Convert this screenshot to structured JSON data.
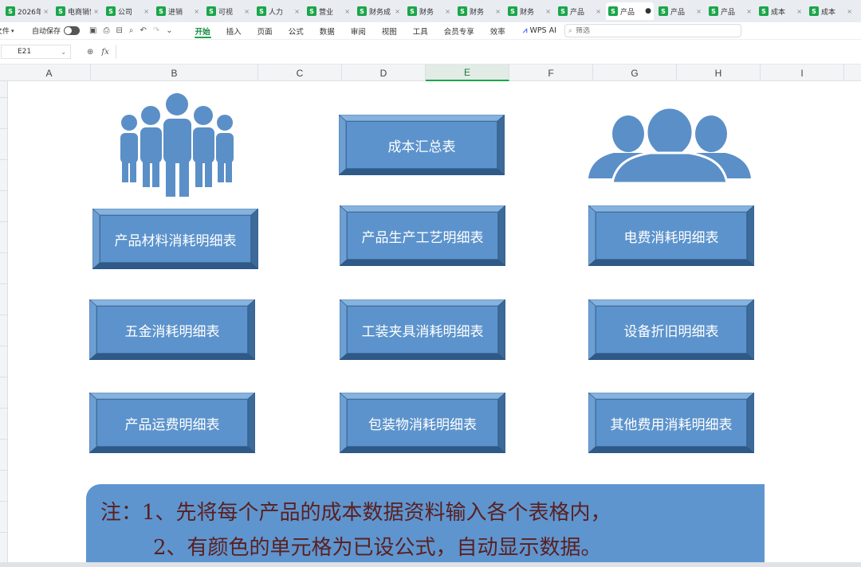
{
  "tabs": [
    {
      "name": "2026年",
      "active": false
    },
    {
      "name": "电商销售",
      "active": false
    },
    {
      "name": "公司",
      "active": false
    },
    {
      "name": "进销",
      "active": false
    },
    {
      "name": "可视",
      "active": false
    },
    {
      "name": "人力",
      "active": false
    },
    {
      "name": "营业",
      "active": false
    },
    {
      "name": "财务成",
      "active": false
    },
    {
      "name": "财务",
      "active": false
    },
    {
      "name": "财务",
      "active": false
    },
    {
      "name": "财务",
      "active": false
    },
    {
      "name": "产品",
      "active": false
    },
    {
      "name": "产品",
      "active": true
    },
    {
      "name": "产品",
      "active": false
    },
    {
      "name": "产品",
      "active": false
    },
    {
      "name": "成本",
      "active": false
    },
    {
      "name": "成本",
      "active": false
    }
  ],
  "tab_icon_letter": "S",
  "toolbar": {
    "file_label": "文件",
    "autosave_label": "自动保存",
    "menus": [
      "开始",
      "插入",
      "页面",
      "公式",
      "数据",
      "审阅",
      "视图",
      "工具",
      "会员专享",
      "效率"
    ],
    "active_menu": "开始",
    "wps_ai_label": "WPS AI",
    "search_placeholder": "筛选"
  },
  "formula_bar": {
    "cell_ref": "E21",
    "fx_label": "fx",
    "formula": ""
  },
  "columns": [
    "A",
    "B",
    "C",
    "D",
    "E",
    "F",
    "G",
    "H",
    "I"
  ],
  "selected_column": "E",
  "buttons": {
    "summary": "成本汇总表",
    "material": "产品材料消耗明细表",
    "process": "产品生产工艺明细表",
    "electric": "电费消耗明细表",
    "hardware": "五金消耗明细表",
    "fixture": "工装夹具消耗明细表",
    "depreciation": "设备折旧明细表",
    "freight": "产品运费明细表",
    "packaging": "包装物消耗明细表",
    "other": "其他费用消耗明细表"
  },
  "note": {
    "line1": "注：1、先将每个产品的成本数据资料输入各个表格内，",
    "line2": "2、有颜色的单元格为已设公式，自动显示数据。"
  },
  "colors": {
    "button_face": "#5c93cc",
    "button_bevel": "#4a7fb8",
    "icon_blue": "#5b8fc8",
    "note_bg": "#5e95cf",
    "note_text": "#5a1f1f",
    "accent_green": "#1aa64a"
  }
}
